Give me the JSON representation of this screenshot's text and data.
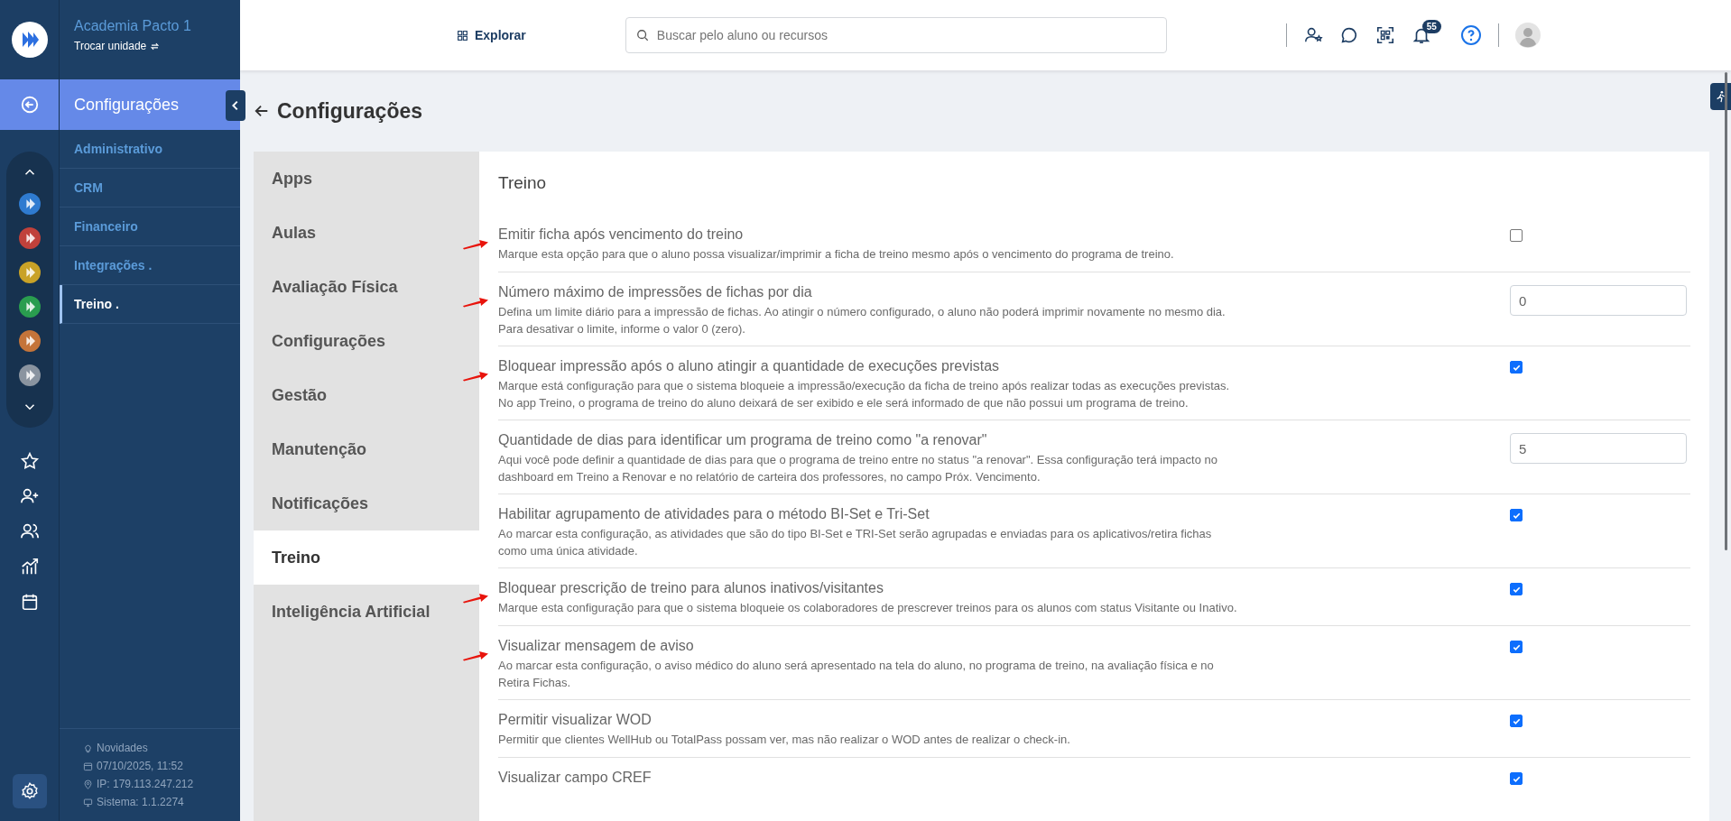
{
  "rail": {
    "modules": [
      {
        "color": "#2f7bd0"
      },
      {
        "color": "#c0413b"
      },
      {
        "color": "#c9a227"
      },
      {
        "color": "#2a9d4f"
      },
      {
        "color": "#c4743a"
      },
      {
        "color": "#8a94a0"
      }
    ]
  },
  "sidebar": {
    "unit_name": "Academia Pacto 1",
    "switch_link": "Trocar unidade",
    "section_title": "Configurações",
    "items": [
      {
        "label": "Administrativo",
        "selected": false
      },
      {
        "label": "CRM",
        "selected": false
      },
      {
        "label": "Financeiro",
        "selected": false
      },
      {
        "label": "Integrações .",
        "selected": false
      },
      {
        "label": "Treino .",
        "selected": true
      }
    ],
    "footer": [
      {
        "kind": "bulb",
        "text": "Novidades"
      },
      {
        "kind": "calendar",
        "text": "07/10/2025, 11:52"
      },
      {
        "kind": "pin",
        "text": "IP: 179.113.247.212"
      },
      {
        "kind": "monitor",
        "text": "Sistema: 1.1.2274"
      }
    ]
  },
  "topbar": {
    "explore": "Explorar",
    "search": {
      "placeholder": "Buscar pelo aluno ou recursos"
    },
    "notifications": "55"
  },
  "page_title": "Configurações",
  "tabs": [
    {
      "label": "Apps",
      "selected": false
    },
    {
      "label": "Aulas",
      "selected": false
    },
    {
      "label": "Avaliação Física",
      "selected": false
    },
    {
      "label": "Configurações",
      "selected": false
    },
    {
      "label": "Gestão",
      "selected": false
    },
    {
      "label": "Manutenção",
      "selected": false
    },
    {
      "label": "Notificações",
      "selected": false
    },
    {
      "label": "Treino",
      "selected": true
    },
    {
      "label": "Inteligência Artificial",
      "selected": false
    }
  ],
  "section_title": "Treino",
  "settings": [
    {
      "kind": "checkbox",
      "marked": true,
      "checked": false,
      "title": "Emitir ficha após vencimento do treino",
      "description": [
        "Marque esta opção para que o aluno possa visualizar/imprimir a ficha de treino mesmo após o vencimento do programa de treino."
      ]
    },
    {
      "kind": "number",
      "marked": true,
      "value": "0",
      "title": "Número máximo de impressões de fichas por dia",
      "description": [
        "Defina um limite diário para a impressão de fichas. Ao atingir o número configurado, o aluno não poderá imprimir novamente no mesmo dia.",
        "Para desativar o limite, informe o valor 0 (zero)."
      ]
    },
    {
      "kind": "checkbox",
      "marked": true,
      "checked": true,
      "title": "Bloquear impressão após o aluno atingir a quantidade de execuções previstas",
      "description": [
        "Marque está configuração para que o sistema bloqueie a impressão/execução da ficha de treino após realizar todas as execuções previstas.",
        "No app Treino, o programa de treino do aluno deixará de ser exibido e ele será informado de que não possui um programa de treino."
      ]
    },
    {
      "kind": "number",
      "marked": false,
      "value": "5",
      "title": "Quantidade de dias para identificar um programa de treino como \"a renovar\"",
      "description": [
        "Aqui você pode definir a quantidade de dias para que o programa de treino entre no status \"a renovar\". Essa configuração terá impacto no",
        "dashboard em Treino a Renovar e no relatório de carteira dos professores, no campo Próx. Vencimento."
      ]
    },
    {
      "kind": "checkbox",
      "marked": false,
      "checked": true,
      "title": "Habilitar agrupamento de atividades para o método BI-Set e Tri-Set",
      "description": [
        "Ao marcar esta configuração, as atividades que são do tipo BI-Set e TRI-Set serão agrupadas e enviadas para os aplicativos/retira fichas",
        "como uma única atividade."
      ]
    },
    {
      "kind": "checkbox",
      "marked": true,
      "checked": true,
      "title": "Bloquear prescrição de treino para alunos inativos/visitantes",
      "description": [
        "Marque esta configuração para que o sistema bloqueie os colaboradores de prescrever treinos para os alunos com status Visitante ou Inativo."
      ]
    },
    {
      "kind": "checkbox",
      "marked": true,
      "checked": true,
      "title": "Visualizar mensagem de aviso",
      "description": [
        "Ao marcar esta configuração, o aviso médico do aluno será apresentado na tela do aluno, no programa de treino, na avaliação física e no",
        "Retira Fichas."
      ]
    },
    {
      "kind": "checkbox",
      "marked": false,
      "checked": true,
      "title": "Permitir visualizar WOD",
      "description": [
        "Permitir que clientes WellHub ou TotalPass possam ver, mas não realizar o WOD antes de realizar o check-in."
      ]
    },
    {
      "kind": "checkbox",
      "marked": false,
      "checked": true,
      "title": "Visualizar campo CREF"
    }
  ]
}
